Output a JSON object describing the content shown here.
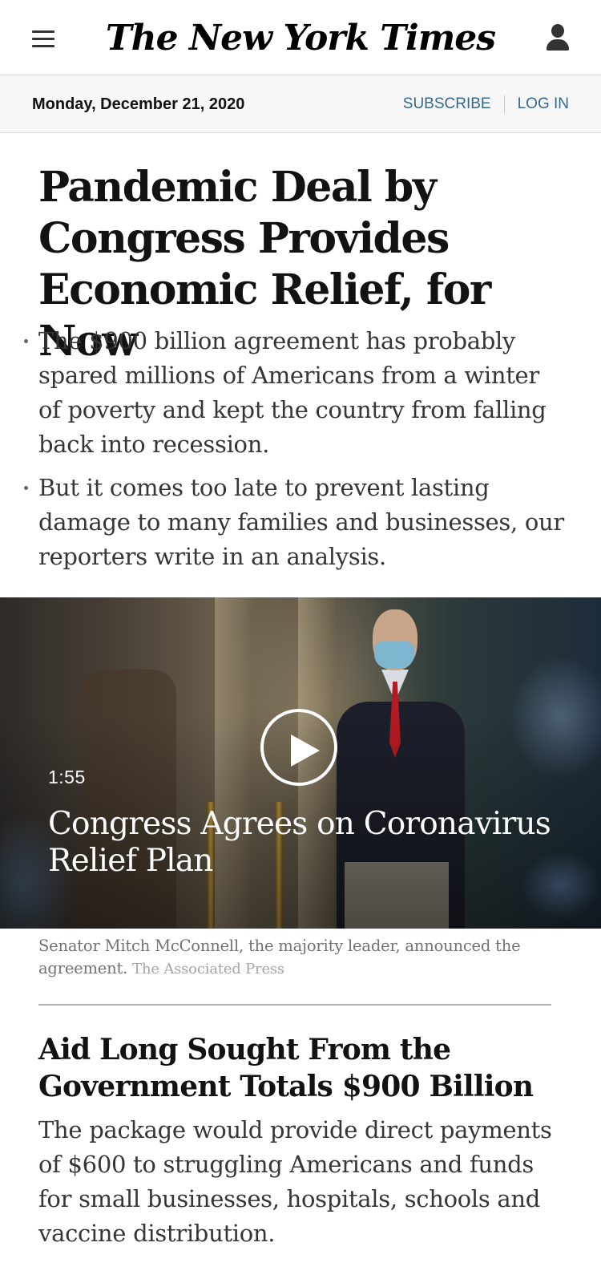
{
  "header": {
    "logo_text": "The New York Times",
    "menu_icon": "hamburger-menu-icon",
    "account_icon": "user-account-icon"
  },
  "datebar": {
    "date": "Monday, December 21, 2020",
    "subscribe_label": "SUBSCRIBE",
    "login_label": "LOG IN"
  },
  "lead_story": {
    "headline": "Pandemic Deal by Congress Provides Economic Relief, for Now",
    "bullets": [
      "The $900 billion agreement has probably spared millions of Americans from a winter of poverty and kept the country from falling back into recession.",
      "But it comes too late to prevent lasting damage to many families and businesses, our reporters write in an analysis."
    ]
  },
  "video": {
    "duration": "1:55",
    "title": "Congress Agrees on Coronavirus Relief Plan",
    "play_icon": "play-icon",
    "caption": "Senator Mitch McConnell, the majority leader, announced the agreement.",
    "credit": "The Associated Press"
  },
  "second_story": {
    "headline": "Aid Long Sought From the Government Totals $900 Billion",
    "summary": "The package would provide direct payments of $600 to struggling Americans and funds for small businesses, hospitals, schools and vaccine distribution."
  },
  "colors": {
    "link_blue": "#326891",
    "text_dark": "#121212",
    "summary_gray": "#363636",
    "caption_gray": "#727272",
    "datebar_bg": "#f7f7f7"
  }
}
